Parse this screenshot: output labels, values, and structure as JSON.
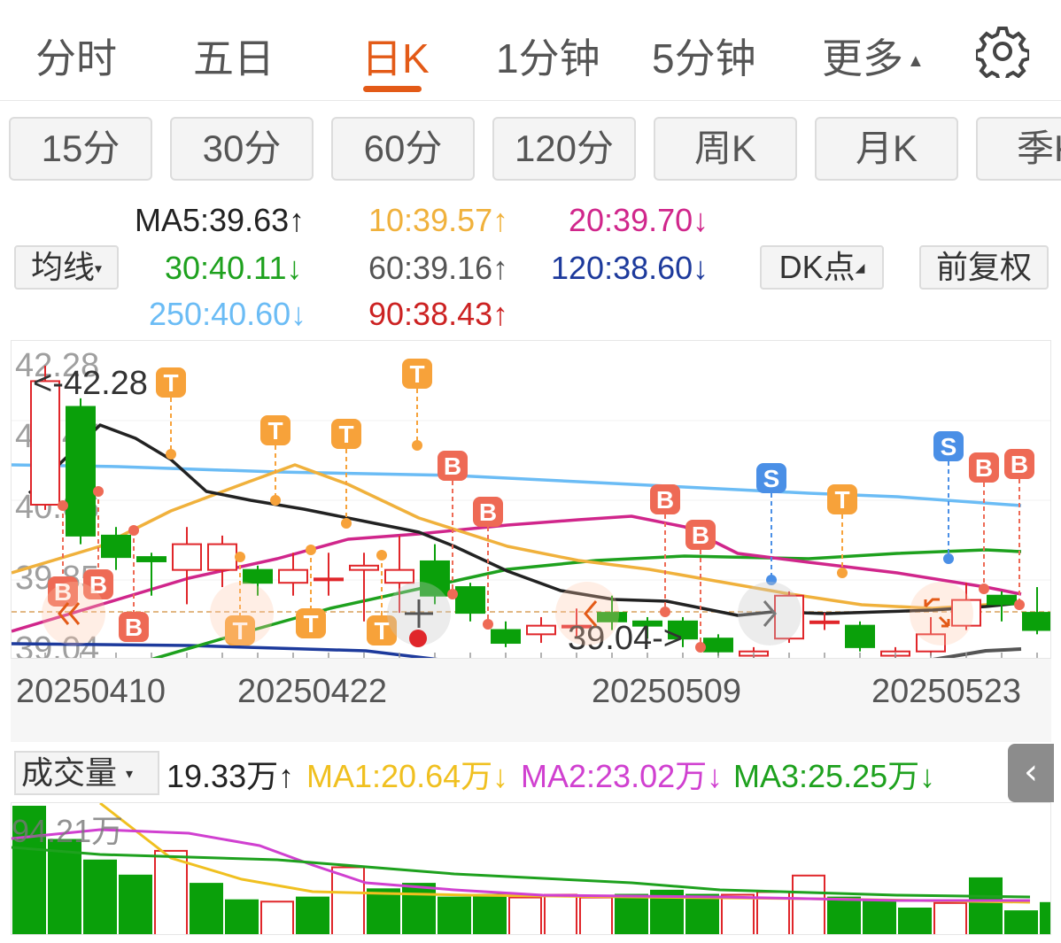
{
  "tabs": [
    "分时",
    "五日",
    "日K",
    "1分钟",
    "5分钟",
    "更多"
  ],
  "active_tab": "日K",
  "more_caret": "▲",
  "periods": [
    "15分",
    "30分",
    "60分",
    "120分",
    "周K",
    "月K",
    "季K"
  ],
  "ma_selector": {
    "label": "均线",
    "caret": "▾"
  },
  "ma": {
    "ma5": "MA5:39.63↑",
    "ma10": "10:39.57↑",
    "ma20": "20:39.70↓",
    "ma30": "30:40.11↓",
    "ma60": "60:39.16↑",
    "ma120": "120:38.60↓",
    "ma250": "250:40.60↓",
    "ma90": "90:38.43↑"
  },
  "dk_button": "DK点",
  "fq_button": "前复权",
  "price_axis": [
    "42.28",
    "41.47",
    "40.66",
    "39.85",
    "39.04"
  ],
  "high_marker": "<-42.28",
  "low_marker": "39.04->",
  "dates": [
    "20250410",
    "20250422",
    "20250509",
    "20250523"
  ],
  "volume": {
    "selector": "成交量",
    "caret": "▾",
    "current": "19.33万↑",
    "ma1": "MA1:20.64万↓",
    "ma2": "MA2:23.02万↓",
    "ma3": "MA3:25.25万↓",
    "max_label": "94.21万"
  },
  "signal_labels": {
    "B": "B",
    "T": "T",
    "S": "S"
  },
  "colors": {
    "up": "#e0262a",
    "down": "#0aa00a",
    "accent": "#e35a17",
    "ma5": "#222222",
    "ma10": "#f0b13c",
    "ma20": "#d0268b",
    "ma30": "#1ea11e",
    "ma60": "#555555",
    "ma120": "#1d3a9c",
    "ma250": "#6bbcf5",
    "ma90": "#cc2222",
    "b_marker": "#ee6a55",
    "t_marker": "#f7a23a",
    "s_marker": "#4a8fe6"
  },
  "chart_data": {
    "type": "candlestick",
    "ylim": [
      39.04,
      42.28
    ],
    "candles": [
      {
        "o": 40.66,
        "c": 42.1,
        "h": 42.28,
        "l": 40.6
      },
      {
        "o": 41.8,
        "c": 40.3,
        "h": 41.9,
        "l": 40.2
      },
      {
        "o": 40.3,
        "c": 40.05,
        "h": 40.4,
        "l": 39.9
      },
      {
        "o": 40.05,
        "c": 40.0,
        "h": 40.1,
        "l": 39.6
      },
      {
        "o": 39.9,
        "c": 40.2,
        "h": 40.4,
        "l": 39.5
      },
      {
        "o": 39.9,
        "c": 40.2,
        "h": 40.3,
        "l": 39.7
      },
      {
        "o": 39.9,
        "c": 39.75,
        "h": 39.95,
        "l": 39.6
      },
      {
        "o": 39.75,
        "c": 39.9,
        "h": 40.1,
        "l": 39.6
      },
      {
        "o": 39.8,
        "c": 39.8,
        "h": 40.1,
        "l": 39.6
      },
      {
        "o": 39.9,
        "c": 39.95,
        "h": 40.1,
        "l": 39.3
      },
      {
        "o": 39.75,
        "c": 39.9,
        "h": 40.3,
        "l": 39.4
      },
      {
        "o": 40.0,
        "c": 39.6,
        "h": 40.2,
        "l": 39.5
      },
      {
        "o": 39.7,
        "c": 39.4,
        "h": 39.75,
        "l": 39.3
      },
      {
        "o": 39.2,
        "c": 39.05,
        "h": 39.3,
        "l": 39.0
      },
      {
        "o": 39.15,
        "c": 39.25,
        "h": 39.35,
        "l": 39.05
      },
      {
        "o": 39.25,
        "c": 39.25,
        "h": 39.45,
        "l": 39.1
      },
      {
        "o": 39.4,
        "c": 39.3,
        "h": 39.6,
        "l": 39.2
      },
      {
        "o": 39.3,
        "c": 39.25,
        "h": 39.35,
        "l": 39.1
      },
      {
        "o": 39.3,
        "c": 39.1,
        "h": 39.35,
        "l": 39.0
      },
      {
        "o": 39.1,
        "c": 38.95,
        "h": 39.15,
        "l": 38.9
      },
      {
        "o": 38.9,
        "c": 38.95,
        "h": 39.0,
        "l": 38.8
      },
      {
        "o": 39.1,
        "c": 39.6,
        "h": 39.65,
        "l": 39.05
      },
      {
        "o": 39.3,
        "c": 39.3,
        "h": 39.4,
        "l": 39.2
      },
      {
        "o": 39.25,
        "c": 39.0,
        "h": 39.3,
        "l": 38.95
      },
      {
        "o": 38.9,
        "c": 38.95,
        "h": 39.0,
        "l": 38.8
      },
      {
        "o": 38.95,
        "c": 39.15,
        "h": 39.35,
        "l": 38.9
      },
      {
        "o": 39.25,
        "c": 39.55,
        "h": 39.75,
        "l": 39.2
      },
      {
        "o": 39.6,
        "c": 39.5,
        "h": 39.65,
        "l": 39.3
      },
      {
        "o": 39.4,
        "c": 39.2,
        "h": 39.7,
        "l": 39.15
      }
    ],
    "volume": [
      94.21,
      70,
      55,
      44,
      62,
      38,
      26,
      25,
      28,
      50,
      34,
      38,
      28,
      30,
      28,
      30,
      28,
      30,
      33,
      30,
      30,
      32,
      44,
      28,
      26,
      20,
      24,
      42,
      18,
      24
    ]
  }
}
